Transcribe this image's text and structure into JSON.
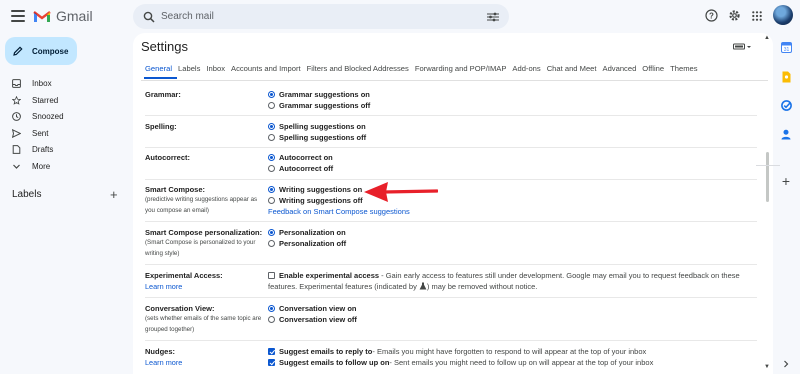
{
  "app": {
    "name": "Gmail"
  },
  "search": {
    "placeholder": "Search mail"
  },
  "compose": {
    "label": "Compose"
  },
  "nav": [
    {
      "label": "Inbox",
      "icon": "inbox-icon"
    },
    {
      "label": "Starred",
      "icon": "star-icon"
    },
    {
      "label": "Snoozed",
      "icon": "clock-icon"
    },
    {
      "label": "Sent",
      "icon": "send-icon"
    },
    {
      "label": "Drafts",
      "icon": "draft-icon"
    },
    {
      "label": "More",
      "icon": "chevron-down-icon"
    }
  ],
  "labels": {
    "heading": "Labels"
  },
  "settings": {
    "title": "Settings",
    "tabs": [
      "General",
      "Labels",
      "Inbox",
      "Accounts and Import",
      "Filters and Blocked Addresses",
      "Forwarding and POP/IMAP",
      "Add-ons",
      "Chat and Meet",
      "Advanced",
      "Offline",
      "Themes"
    ],
    "active_tab": "General"
  },
  "rows": {
    "grammar": {
      "label": "Grammar:",
      "on": "Grammar suggestions on",
      "off": "Grammar suggestions off"
    },
    "spelling": {
      "label": "Spelling:",
      "on": "Spelling suggestions on",
      "off": "Spelling suggestions off"
    },
    "autocorrect": {
      "label": "Autocorrect:",
      "on": "Autocorrect on",
      "off": "Autocorrect off"
    },
    "smart_compose": {
      "label": "Smart Compose:",
      "sub": "(predictive writing suggestions appear as you compose an email)",
      "on": "Writing suggestions on",
      "off": "Writing suggestions off",
      "feedback": "Feedback on Smart Compose suggestions"
    },
    "personalization": {
      "label": "Smart Compose personalization:",
      "sub": "(Smart Compose is personalized to your writing style)",
      "on": "Personalization on",
      "off": "Personalization off"
    },
    "experimental": {
      "label": "Experimental Access:",
      "link": "Learn more",
      "check_label": "Enable experimental access",
      "desc1": " - Gain early access to features still under development. Google may email you to request feedback on these",
      "desc2": "features. Experimental features (indicated by ",
      "desc3": ") may be removed without notice."
    },
    "conversation": {
      "label": "Conversation View:",
      "sub": "(sets whether emails of the same topic are grouped together)",
      "on": "Conversation view on",
      "off": "Conversation view off"
    },
    "nudges": {
      "label": "Nudges:",
      "link": "Learn more",
      "reply_label": "Suggest emails to reply to",
      "reply_desc": " - Emails you might have forgotten to respond to will appear at the top of your inbox",
      "follow_label": "Suggest emails to follow up on",
      "follow_desc": " - Sent emails you might need to follow up on will appear at the top of your inbox"
    }
  },
  "colors": {
    "accent": "#0b57d0",
    "annotation_arrow": "#e8202a",
    "compose_bg": "#c2e7ff"
  }
}
